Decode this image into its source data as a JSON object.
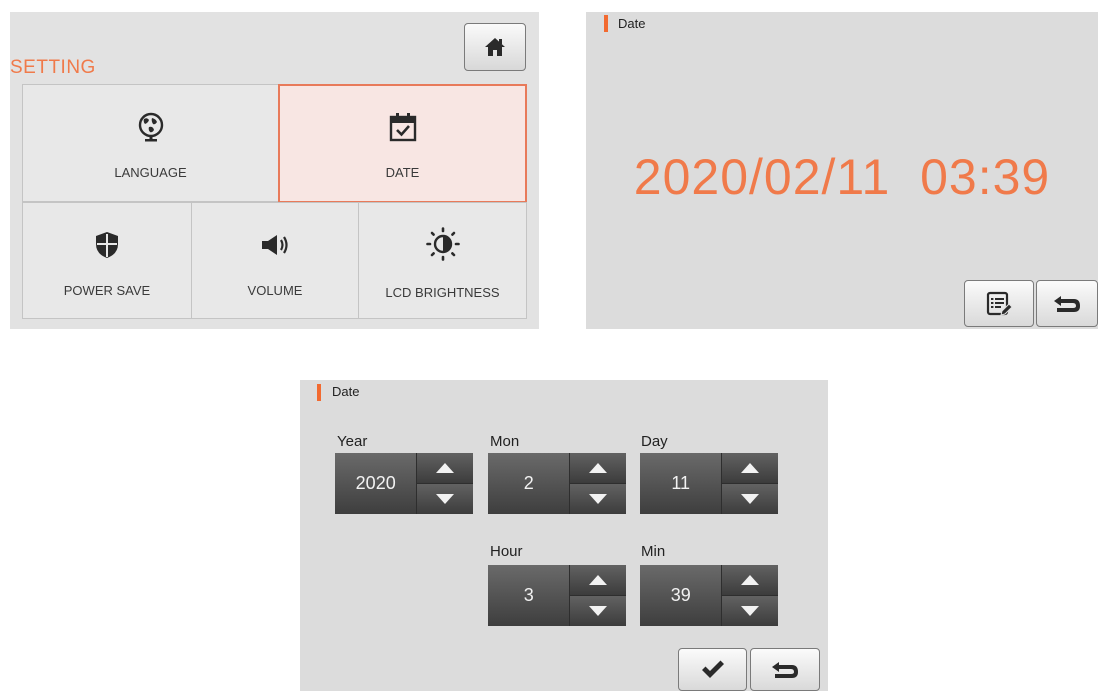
{
  "settings": {
    "title": "SETTING",
    "home_icon": "home-icon",
    "accent": "#f07a4a",
    "tiles": {
      "language": {
        "label": "LANGUAGE",
        "icon": "globe-icon"
      },
      "date": {
        "label": "DATE",
        "icon": "calendar-check-icon",
        "selected": true
      },
      "power_save": {
        "label": "POWER SAVE",
        "icon": "shield-icon"
      },
      "volume": {
        "label": "VOLUME",
        "icon": "speaker-icon"
      },
      "brightness": {
        "label": "LCD BRIGHTNESS",
        "icon": "brightness-icon"
      }
    }
  },
  "date_view": {
    "header": "Date",
    "date": "2020/02/11",
    "time": "03:39",
    "edit_icon": "edit-list-icon",
    "back_icon": "return-icon"
  },
  "date_edit": {
    "header": "Date",
    "fields": {
      "year": {
        "label": "Year",
        "value": "2020"
      },
      "mon": {
        "label": "Mon",
        "value": "2"
      },
      "day": {
        "label": "Day",
        "value": "11"
      },
      "hour": {
        "label": "Hour",
        "value": "3"
      },
      "min": {
        "label": "Min",
        "value": "39"
      }
    },
    "confirm_icon": "check-icon",
    "back_icon": "return-icon"
  }
}
